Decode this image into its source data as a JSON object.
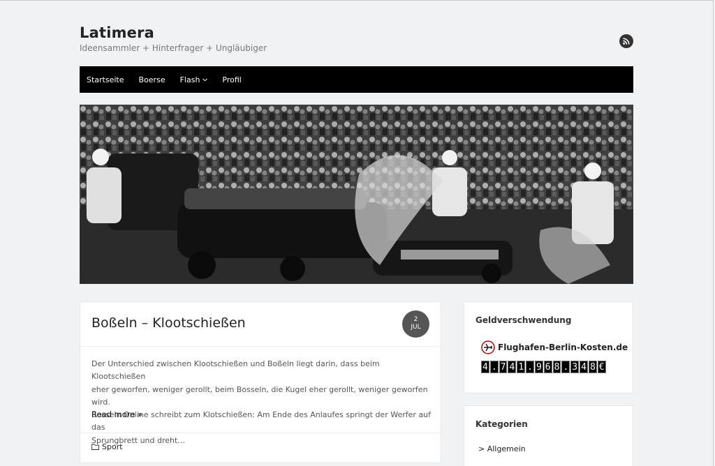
{
  "site": {
    "title": "Latimera",
    "description": "Ideensammler + Hinterfrager + Ungläubiger"
  },
  "nav": {
    "items": [
      {
        "label": "Startseite"
      },
      {
        "label": "Boerse"
      },
      {
        "label": "Flash"
      },
      {
        "label": "Profil"
      }
    ]
  },
  "hero": {
    "alt": "Motorcade"
  },
  "post": {
    "title": "Boßeln – Klootschießen",
    "date_day": "2",
    "date_month": "JUL",
    "excerpt_line1": "Der Unterschied zwischen Klootschießen und Boßeln liegt darin, dass beim Klootschießen",
    "excerpt_line2": "eher geworfen, weniger gerollt, beim Bosseln, die Kugel eher gerollt, weniger geworfen wird.",
    "excerpt_line3": "Bosseln Online schreibt zum Klotschießen: Am Ende des Anlaufes springt der Werfer auf das",
    "excerpt_line4": "Sprungbrett und dreht…",
    "read_more": "Read more »",
    "category": "Sport"
  },
  "widgets": {
    "geld": {
      "title": "Geldverschwendung",
      "link_text": "Flughafen-Berlin-Kosten.de",
      "counter": [
        "4",
        ".",
        "7",
        "4",
        "1",
        ".",
        "9",
        "6",
        "8",
        ".",
        "3",
        "4",
        "8",
        "€"
      ]
    },
    "kategorien": {
      "title": "Kategorien",
      "items": [
        {
          "label": "> Allgemein"
        }
      ]
    }
  },
  "colors": {
    "nav_bg": "#000000",
    "page_bg": "#f0f2f4",
    "badge_bg": "#555555"
  },
  "icons": {
    "rss": "rss-icon",
    "dropdown": "chevron-down-icon",
    "folder": "folder-icon",
    "plane": "airplane-icon"
  }
}
